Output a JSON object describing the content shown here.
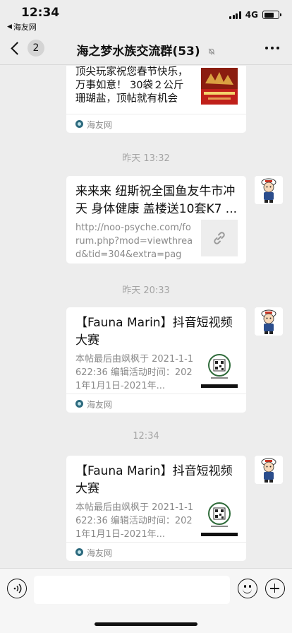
{
  "status_bar": {
    "time": "12:34",
    "back_app": "海友网",
    "network": "4G",
    "battery_level": 0.7
  },
  "nav": {
    "back_count": "2",
    "title": "海之梦水族交流群(53)",
    "mute_icon": "bell-slash-icon",
    "more_icon": "more-dots-icon"
  },
  "messages": [
    {
      "kind": "card",
      "title": "",
      "desc": "顶尖玩家祝您春节快乐，万事如意！ 30袋２公斤珊瑚盐，顶帖就有机会获...",
      "source": "海友网",
      "thumb_icon": "festival-banner-thumbnail"
    },
    {
      "kind": "time",
      "text": "昨天 13:32"
    },
    {
      "kind": "card",
      "title": "来来来 纽斯祝全国鱼友牛市冲天 身体健康 盖楼送10套K7 ...",
      "desc": "http://noo-psyche.com/forum.php?mod=viewthread&tid=304&extra=page...",
      "source": "",
      "thumb_icon": "link-icon"
    },
    {
      "kind": "time",
      "text": "昨天 20:33"
    },
    {
      "kind": "card",
      "title": "【Fauna Marin】抖音短视频大赛",
      "desc": "本帖最后由飒枫于 2021-1-1622:36 编辑活动时间：2021年1月1日-2021年...",
      "source": "海友网",
      "thumb_icon": "qr-code-thumbnail"
    },
    {
      "kind": "time",
      "text": "12:34"
    },
    {
      "kind": "card",
      "title": "【Fauna Marin】抖音短视频大赛",
      "desc": "本帖最后由飒枫于 2021-1-1622:36 编辑活动时间：2021年1月1日-2021年...",
      "source": "海友网",
      "thumb_icon": "qr-code-thumbnail"
    }
  ],
  "input_bar": {
    "voice_icon": "voice-icon",
    "emoji_icon": "emoji-icon",
    "plus_icon": "plus-circle-icon",
    "text": ""
  }
}
